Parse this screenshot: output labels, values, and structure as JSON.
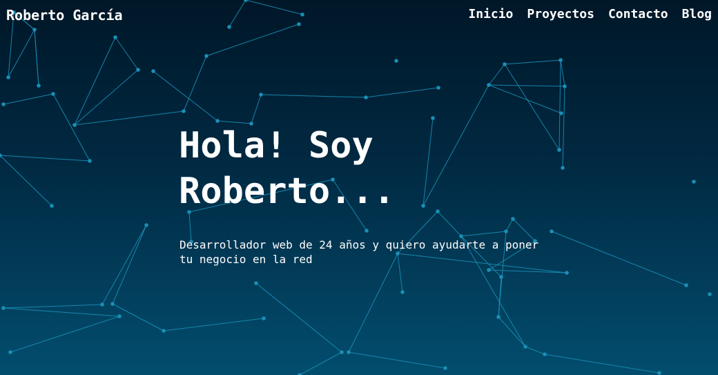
{
  "header": {
    "brand_name": "Roberto García",
    "nav_items": [
      {
        "label": "Inicio"
      },
      {
        "label": "Proyectos"
      },
      {
        "label": "Contacto"
      },
      {
        "label": "Blog"
      }
    ]
  },
  "hero": {
    "title": "Hola! Soy Roberto...",
    "subtitle": "Desarrollador web de 24 años y quiero ayudarte a poner tu negocio en la red"
  },
  "theme": {
    "background_top": "#001728",
    "background_bottom": "#024d6e",
    "network_color": "#1a8fb6",
    "text_color": "#ffffff"
  }
}
